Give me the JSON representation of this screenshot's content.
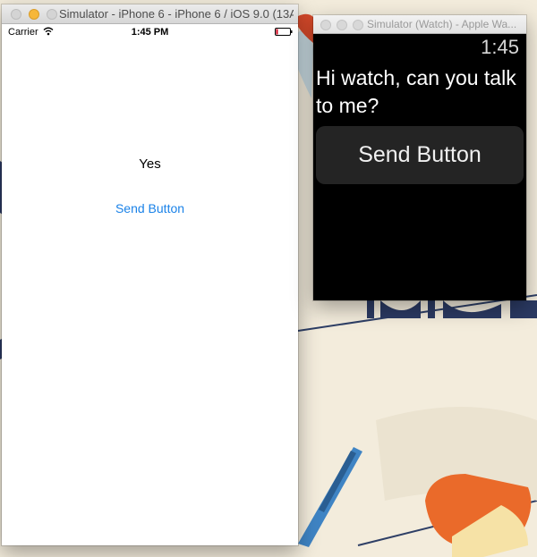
{
  "phone_simulator": {
    "window_title": "Simulator - iPhone 6 - iPhone 6 / iOS 9.0 (13A...",
    "status_bar": {
      "carrier": "Carrier",
      "time": "1:45 PM"
    },
    "label_text": "Yes",
    "send_button_label": "Send Button",
    "accent_color": "#1a82e8"
  },
  "watch_simulator": {
    "window_title": "Simulator (Watch) - Apple Wa...",
    "time": "1:45",
    "message": "Hi watch, can you talk to me?",
    "send_button_label": "Send Button"
  },
  "icons": [
    "wifi-icon",
    "battery-icon"
  ]
}
